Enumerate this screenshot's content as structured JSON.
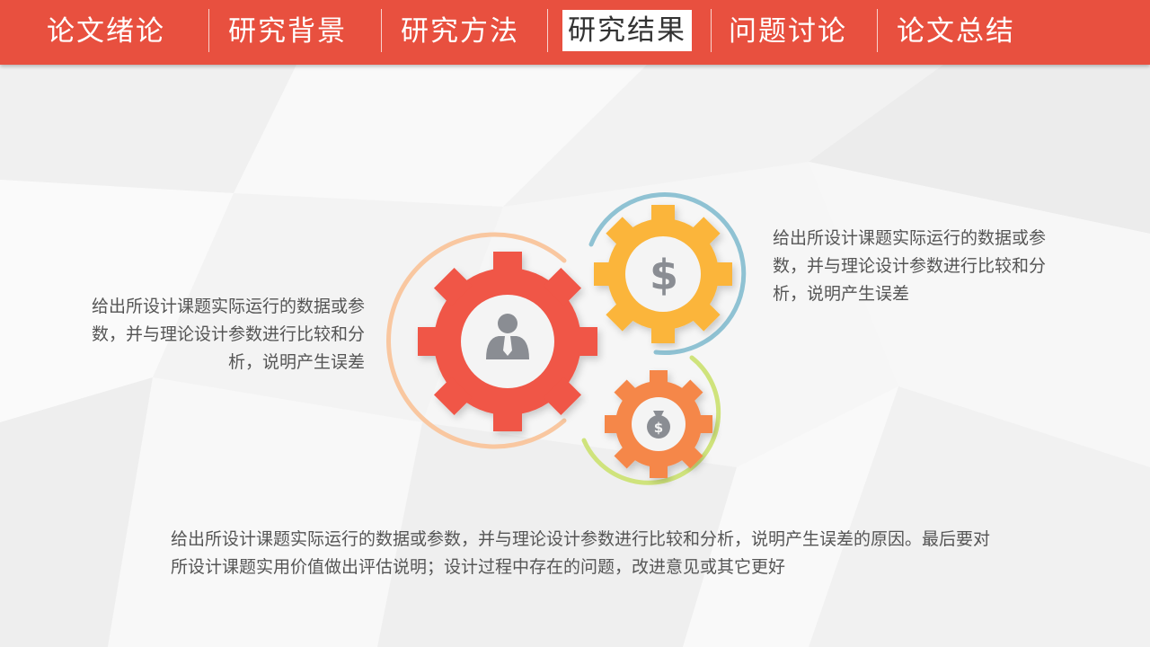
{
  "nav": {
    "items": [
      {
        "label": "论文绪论"
      },
      {
        "label": "研究背景"
      },
      {
        "label": "研究方法"
      },
      {
        "label": "研究结果"
      },
      {
        "label": "问题讨论"
      },
      {
        "label": "论文总结"
      }
    ],
    "active": "研究结果"
  },
  "content": {
    "left_text": "给出所设计课题实际运行的数据或参数，并与理论设计参数进行比较和分析，说明产生误差",
    "right_text": "给出所设计课题实际运行的数据或参数，并与理论设计参数进行比较和分析，说明产生误差",
    "bottom_text": "给出所设计课题实际运行的数据或参数，并与理论设计参数进行比较和分析，说明产生误差的原因。最后要对所设计课题实用价值做出评估说明；设计过程中存在的问题，改进意见或其它更好",
    "dollar_symbol": "$"
  },
  "colors": {
    "header": "#e8503f",
    "gear_red": "#f05646",
    "gear_yellow": "#fbb53a",
    "gear_orange": "#f5874a",
    "ring_peach": "#f9c7a0",
    "ring_blue": "#8fc2d3",
    "ring_green": "#cfe37c",
    "icon_gray": "#8a8d93"
  },
  "icons": [
    "user-icon",
    "dollar-icon",
    "money-bag-icon"
  ]
}
